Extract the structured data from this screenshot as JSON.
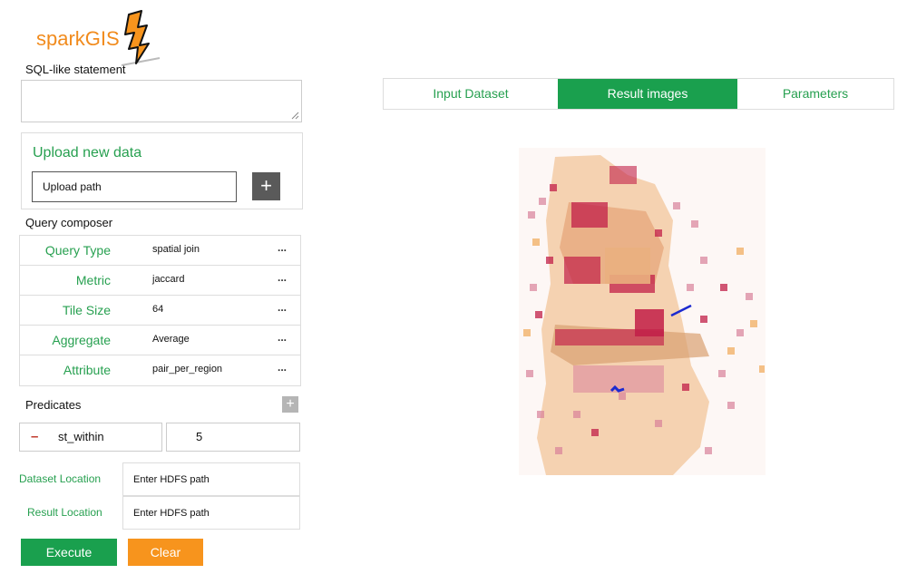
{
  "logo": {
    "text": "sparkGIS"
  },
  "sql": {
    "label": "SQL-like statement",
    "value": ""
  },
  "upload": {
    "title": "Upload new data",
    "path_value": "Upload path",
    "add_icon": "plus-icon"
  },
  "composer": {
    "label": "Query composer",
    "rows": [
      {
        "label": "Query Type",
        "value": "spatial join",
        "more": "..."
      },
      {
        "label": "Metric",
        "value": "jaccard",
        "more": "..."
      },
      {
        "label": "Tile Size",
        "value": "64",
        "more": "..."
      },
      {
        "label": "Aggregate",
        "value": "Average",
        "more": "..."
      },
      {
        "label": "Attribute",
        "value": "pair_per_region",
        "more": "..."
      }
    ]
  },
  "predicates": {
    "label": "Predicates",
    "add_icon": "plus-icon",
    "items": [
      {
        "remove_icon": "minus-icon",
        "name": "st_within",
        "value": "5"
      }
    ]
  },
  "locations": {
    "dataset": {
      "label": "Dataset Location",
      "value": "Enter HDFS path"
    },
    "result": {
      "label": "Result Location",
      "value": "Enter HDFS path"
    }
  },
  "actions": {
    "execute": "Execute",
    "clear": "Clear"
  },
  "tabs": [
    {
      "label": "Input Dataset",
      "active": false
    },
    {
      "label": "Result images",
      "active": true
    },
    {
      "label": "Parameters",
      "active": false
    }
  ],
  "colors": {
    "green": "#1aa04e",
    "orange": "#f7941d",
    "logo_orange": "#f18b1d",
    "heat_low": "#f3b36b",
    "heat_mid": "#d9829a",
    "heat_high": "#c21f48",
    "annotation_blue": "#1c2ad0"
  }
}
